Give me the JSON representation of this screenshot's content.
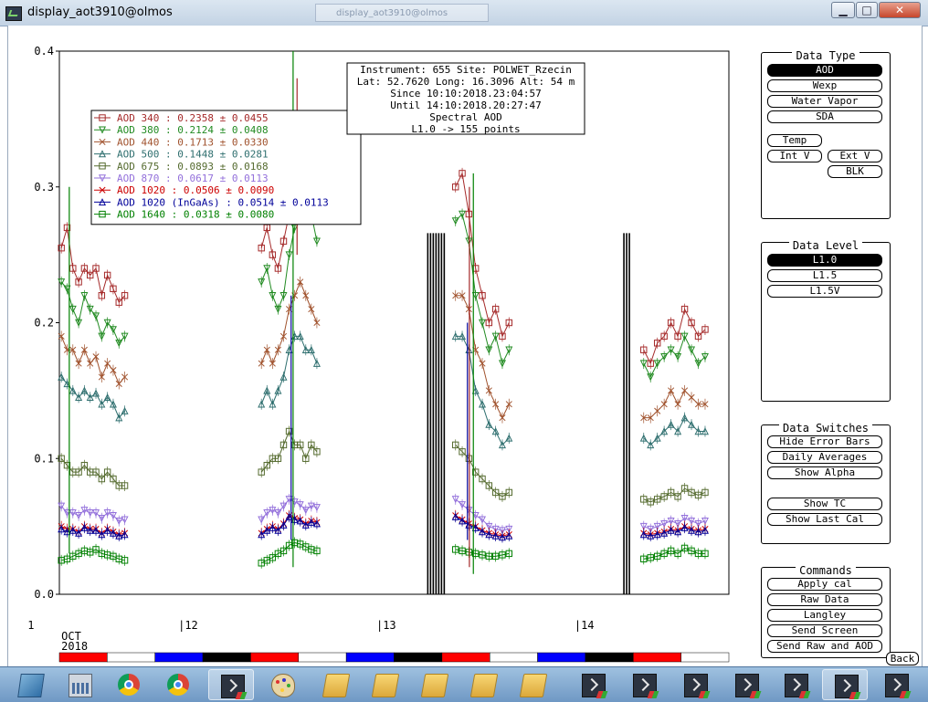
{
  "window": {
    "title": "display_aot3910@olmos",
    "ghost_title": "display_aot3910@olmos",
    "min_label": "▁",
    "max_label": "□",
    "close_label": "✕"
  },
  "chart_data": {
    "type": "scatter",
    "info_box": [
      "Instrument: 655 Site: POLWET_Rzecin",
      "Lat: 52.7620 Long: 16.3096 Alt: 54 m",
      "Since 10:10:2018.23:04:57",
      "Until 14:10:2018.20:27:47",
      "Spectral AOD",
      "L1.0 -> 155 points"
    ],
    "ylim": [
      0,
      0.4
    ],
    "y_ticks": [
      "0.0",
      "0.1",
      "0.2",
      "0.3",
      "0.4"
    ],
    "y_tick_values": [
      0,
      0.1,
      0.2,
      0.3,
      0.4
    ],
    "xlim": [
      11.4,
      14.78
    ],
    "x_ticks": [
      {
        "value": 11.24,
        "label": "1"
      },
      {
        "value": 12.0,
        "label": "|12"
      },
      {
        "value": 13.0,
        "label": "|13"
      },
      {
        "value": 14.0,
        "label": "|14"
      }
    ],
    "month_label": "OCT",
    "year_label": "2018",
    "legend": [
      {
        "label": "AOD 340",
        "mean": "0.2358",
        "sd": "0.0455",
        "color": "#a52a2a",
        "marker": "square"
      },
      {
        "label": "AOD 380",
        "mean": "0.2124",
        "sd": "0.0408",
        "color": "#228b22",
        "marker": "tri_down"
      },
      {
        "label": "AOD 440",
        "mean": "0.1713",
        "sd": "0.0330",
        "color": "#a0522d",
        "marker": "x"
      },
      {
        "label": "AOD 500",
        "mean": "0.1448",
        "sd": "0.0281",
        "color": "#2f6f6f",
        "marker": "tri_up"
      },
      {
        "label": "AOD 675",
        "mean": "0.0893",
        "sd": "0.0168",
        "color": "#556b2f",
        "marker": "square"
      },
      {
        "label": "AOD 870",
        "mean": "0.0617",
        "sd": "0.0113",
        "color": "#9370db",
        "marker": "tri_down"
      },
      {
        "label": "AOD 1020",
        "mean": "0.0506",
        "sd": "0.0090",
        "color": "#cc0000",
        "marker": "x"
      },
      {
        "label": "AOD 1020  (InGaAs)",
        "mean": "0.0514",
        "sd": "0.0113",
        "color": "#000099",
        "marker": "tri_up"
      },
      {
        "label": "AOD 1640",
        "mean": "0.0318",
        "sd": "0.0080",
        "color": "#008000",
        "marker": "square"
      }
    ],
    "series_values": {
      "AOD 340": [
        [
          0.255,
          0.27,
          0.24,
          0.23,
          0.24,
          0.235,
          0.24,
          0.22,
          0.235,
          0.225,
          0.215,
          0.22
        ],
        [
          0.255,
          0.27,
          0.25,
          0.24,
          0.26,
          0.28,
          0.3,
          0.32,
          0.34,
          0.3,
          0.28
        ],
        [
          0.3,
          0.31,
          0.28,
          0.24,
          0.22,
          0.2,
          0.21,
          0.19,
          0.2
        ],
        [
          0.18,
          0.17,
          0.185,
          0.19,
          0.2,
          0.19,
          0.21,
          0.2,
          0.19,
          0.195
        ]
      ],
      "AOD 380": [
        [
          0.23,
          0.225,
          0.21,
          0.2,
          0.22,
          0.21,
          0.205,
          0.19,
          0.2,
          0.195,
          0.185,
          0.19
        ],
        [
          0.23,
          0.24,
          0.22,
          0.21,
          0.22,
          0.25,
          0.27,
          0.29,
          0.31,
          0.28,
          0.26
        ],
        [
          0.275,
          0.28,
          0.26,
          0.22,
          0.2,
          0.18,
          0.19,
          0.17,
          0.18
        ],
        [
          0.17,
          0.16,
          0.17,
          0.175,
          0.18,
          0.175,
          0.19,
          0.18,
          0.17,
          0.175
        ]
      ],
      "AOD 440": [
        [
          0.19,
          0.18,
          0.18,
          0.17,
          0.18,
          0.17,
          0.175,
          0.16,
          0.17,
          0.165,
          0.155,
          0.16
        ],
        [
          0.17,
          0.18,
          0.17,
          0.18,
          0.19,
          0.21,
          0.22,
          0.23,
          0.22,
          0.21,
          0.2
        ],
        [
          0.22,
          0.22,
          0.21,
          0.18,
          0.17,
          0.15,
          0.14,
          0.13,
          0.14
        ],
        [
          0.13,
          0.13,
          0.135,
          0.14,
          0.15,
          0.14,
          0.15,
          0.145,
          0.14,
          0.14
        ]
      ],
      "AOD 500": [
        [
          0.16,
          0.155,
          0.15,
          0.145,
          0.15,
          0.145,
          0.148,
          0.14,
          0.145,
          0.14,
          0.13,
          0.135
        ],
        [
          0.14,
          0.15,
          0.14,
          0.15,
          0.16,
          0.18,
          0.19,
          0.19,
          0.18,
          0.18,
          0.17
        ],
        [
          0.19,
          0.19,
          0.18,
          0.15,
          0.14,
          0.125,
          0.12,
          0.11,
          0.115
        ],
        [
          0.115,
          0.11,
          0.115,
          0.12,
          0.125,
          0.12,
          0.13,
          0.125,
          0.12,
          0.12
        ]
      ],
      "AOD 675": [
        [
          0.1,
          0.095,
          0.09,
          0.09,
          0.095,
          0.09,
          0.09,
          0.085,
          0.09,
          0.085,
          0.08,
          0.08
        ],
        [
          0.09,
          0.095,
          0.1,
          0.1,
          0.11,
          0.12,
          0.11,
          0.11,
          0.1,
          0.11,
          0.105
        ],
        [
          0.11,
          0.105,
          0.1,
          0.09,
          0.085,
          0.08,
          0.075,
          0.072,
          0.075
        ],
        [
          0.07,
          0.068,
          0.07,
          0.072,
          0.075,
          0.072,
          0.078,
          0.075,
          0.073,
          0.075
        ]
      ],
      "AOD 870": [
        [
          0.065,
          0.06,
          0.06,
          0.058,
          0.062,
          0.06,
          0.06,
          0.056,
          0.06,
          0.058,
          0.054,
          0.055
        ],
        [
          0.055,
          0.06,
          0.062,
          0.06,
          0.065,
          0.07,
          0.068,
          0.066,
          0.062,
          0.065,
          0.064
        ],
        [
          0.07,
          0.066,
          0.062,
          0.058,
          0.055,
          0.05,
          0.048,
          0.047,
          0.048
        ],
        [
          0.05,
          0.048,
          0.05,
          0.052,
          0.054,
          0.052,
          0.056,
          0.054,
          0.052,
          0.054
        ]
      ],
      "AOD 1020": [
        [
          0.05,
          0.048,
          0.048,
          0.046,
          0.05,
          0.048,
          0.048,
          0.045,
          0.048,
          0.046,
          0.044,
          0.045
        ],
        [
          0.045,
          0.048,
          0.05,
          0.048,
          0.052,
          0.058,
          0.056,
          0.055,
          0.052,
          0.054,
          0.053
        ],
        [
          0.058,
          0.055,
          0.052,
          0.05,
          0.047,
          0.045,
          0.044,
          0.043,
          0.044
        ],
        [
          0.045,
          0.044,
          0.045,
          0.046,
          0.048,
          0.047,
          0.05,
          0.048,
          0.047,
          0.048
        ]
      ],
      "AOD 1020  (InGaAs)": [
        [
          0.048,
          0.046,
          0.047,
          0.045,
          0.049,
          0.047,
          0.047,
          0.044,
          0.047,
          0.045,
          0.043,
          0.044
        ],
        [
          0.044,
          0.047,
          0.049,
          0.047,
          0.051,
          0.057,
          0.055,
          0.054,
          0.051,
          0.053,
          0.052
        ],
        [
          0.057,
          0.054,
          0.051,
          0.049,
          0.046,
          0.044,
          0.043,
          0.042,
          0.043
        ],
        [
          0.044,
          0.043,
          0.044,
          0.045,
          0.047,
          0.046,
          0.049,
          0.047,
          0.046,
          0.047
        ]
      ],
      "AOD 1640": [
        [
          0.025,
          0.026,
          0.028,
          0.03,
          0.032,
          0.031,
          0.033,
          0.03,
          0.029,
          0.028,
          0.026,
          0.025
        ],
        [
          0.023,
          0.025,
          0.027,
          0.03,
          0.032,
          0.036,
          0.038,
          0.037,
          0.035,
          0.033,
          0.032
        ],
        [
          0.033,
          0.032,
          0.031,
          0.03,
          0.029,
          0.028,
          0.028,
          0.029,
          0.03
        ],
        [
          0.026,
          0.027,
          0.028,
          0.03,
          0.032,
          0.03,
          0.034,
          0.032,
          0.03,
          0.03
        ]
      ]
    },
    "color_bar": [
      "#ff0000",
      "#ffffff",
      "#0000ff",
      "#000000",
      "#ff0000",
      "#ffffff",
      "#0000ff",
      "#000000",
      "#ff0000",
      "#ffffff",
      "#0000ff",
      "#000000",
      "#ff0000",
      "#ffffff"
    ]
  },
  "panels": {
    "data_type": {
      "title": "Data Type",
      "aod": "AOD",
      "wexp": "Wexp",
      "water_vapor": "Water Vapor",
      "sda": "SDA",
      "temp": "Temp",
      "int_v": "Int V",
      "ext_v": "Ext V",
      "blk": "BLK"
    },
    "data_level": {
      "title": "Data Level",
      "l10": "L1.0",
      "l15": "L1.5",
      "l15v": "L1.5V"
    },
    "data_switches": {
      "title": "Data Switches",
      "hide_error_bars": "Hide Error Bars",
      "daily_averages": "Daily Averages",
      "show_alpha": "Show Alpha",
      "show_tc": "Show TC",
      "show_last_cal": "Show Last Cal"
    },
    "commands": {
      "title": "Commands",
      "apply_cal": "Apply cal",
      "raw_data": "Raw Data",
      "langley": "Langley",
      "send_screen": "Send Screen",
      "send_raw_aod": "Send Raw and AOD"
    },
    "back": "Back"
  }
}
